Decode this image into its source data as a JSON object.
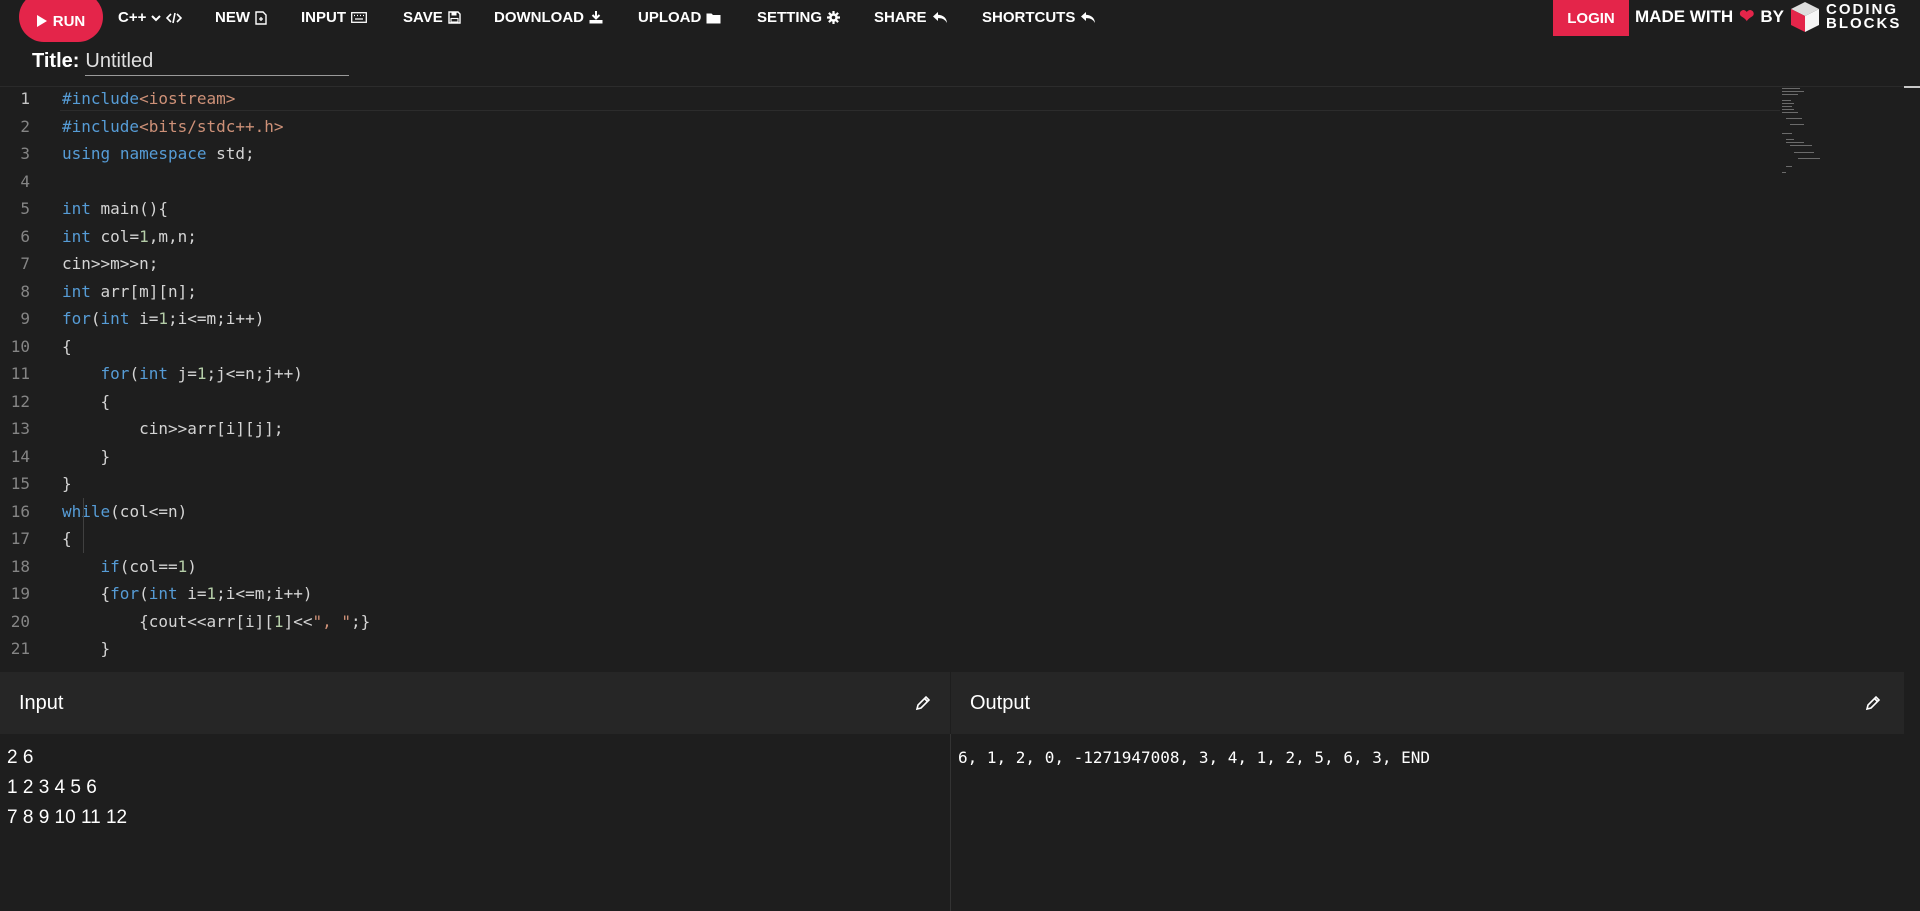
{
  "toolbar": {
    "run_label": "RUN",
    "language_label": "C++",
    "new_label": "NEW",
    "input_label": "INPUT",
    "save_label": "SAVE",
    "download_label": "DOWNLOAD",
    "upload_label": "UPLOAD",
    "setting_label": "SETTING",
    "share_label": "SHARE",
    "shortcuts_label": "SHORTCUTS",
    "login_label": "LOGIN",
    "made_with_label": "MADE WITH",
    "by_label": "BY",
    "brand_line1": "CODING",
    "brand_line2": "BLOCKS"
  },
  "title": {
    "label": "Title:",
    "value": "Untitled"
  },
  "editor": {
    "active_line": 1,
    "lines": [
      {
        "n": "1",
        "html": "<span class='tk-kw'>#include</span><span class='tk-str'>&lt;iostream&gt;</span>"
      },
      {
        "n": "2",
        "html": "<span class='tk-kw'>#include</span><span class='tk-str'>&lt;bits/stdc++.h&gt;</span>"
      },
      {
        "n": "3",
        "html": "<span class='tk-kw'>using</span> <span class='tk-kw'>namespace</span> std;"
      },
      {
        "n": "4",
        "html": ""
      },
      {
        "n": "5",
        "html": "<span class='tk-kw'>int</span> main(){"
      },
      {
        "n": "6",
        "html": "<span class='tk-kw'>int</span> col=<span class='tk-num'>1</span>,m,n;"
      },
      {
        "n": "7",
        "html": "cin&gt;&gt;m&gt;&gt;n;"
      },
      {
        "n": "8",
        "html": "<span class='tk-kw'>int</span> arr[m][n];"
      },
      {
        "n": "9",
        "html": "<span class='tk-kw'>for</span>(<span class='tk-kw'>int</span> i=<span class='tk-num'>1</span>;i&lt;=m;i++)"
      },
      {
        "n": "10",
        "html": "{"
      },
      {
        "n": "11",
        "html": "    <span class='tk-kw'>for</span>(<span class='tk-kw'>int</span> j=<span class='tk-num'>1</span>;j&lt;=n;j++)"
      },
      {
        "n": "12",
        "html": "    {"
      },
      {
        "n": "13",
        "html": "        cin&gt;&gt;arr[i][j];"
      },
      {
        "n": "14",
        "html": "    }"
      },
      {
        "n": "15",
        "html": "}"
      },
      {
        "n": "16",
        "html": "<span class='tk-kw'>while</span>(col&lt;=n)"
      },
      {
        "n": "17",
        "html": "{"
      },
      {
        "n": "18",
        "html": "    <span class='tk-kw'>if</span>(col==<span class='tk-num'>1</span>)"
      },
      {
        "n": "19",
        "html": "    {<span class='tk-kw'>for</span>(<span class='tk-kw'>int</span> i=<span class='tk-num'>1</span>;i&lt;=m;i++)"
      },
      {
        "n": "20",
        "html": "        {cout&lt;&lt;arr[i][<span class='tk-num'>1</span>]&lt;&lt;<span class='tk-str'>\", \"</span>;}"
      },
      {
        "n": "21",
        "html": "    }"
      }
    ]
  },
  "input_panel": {
    "title": "Input",
    "lines": [
      "2 6",
      "1 2 3 4 5 6",
      "7 8 9 10 11 12"
    ]
  },
  "output_panel": {
    "title": "Output",
    "lines": [
      "6, 1, 2, 0, -1271947008, 3, 4, 1, 2, 5, 6, 3, END"
    ]
  },
  "colors": {
    "accent": "#e4254a",
    "background": "#1e1e1e",
    "panel_header": "#262626",
    "keyword": "#569cd6",
    "string": "#ce9178",
    "number": "#b5cea8"
  },
  "icons": {
    "run": "play-icon",
    "language": "chevron-down-icon",
    "code": "code-brackets-icon",
    "new": "new-file-icon",
    "input": "keyboard-icon",
    "save": "floppy-icon",
    "download": "download-icon",
    "upload": "folder-icon",
    "setting": "gear-icon",
    "share": "share-icon",
    "shortcuts": "shortcut-icon",
    "edit": "pencil-icon"
  }
}
